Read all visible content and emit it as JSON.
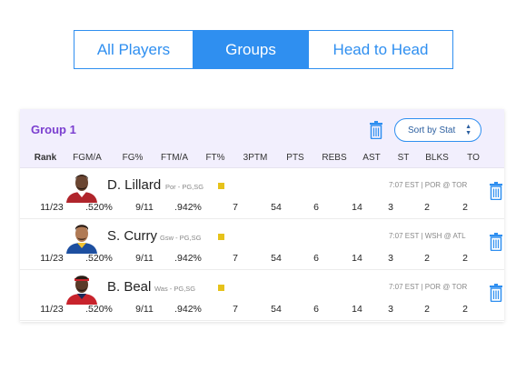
{
  "tabs": [
    {
      "label": "All Players",
      "active": false
    },
    {
      "label": "Groups",
      "active": true
    },
    {
      "label": "Head to Head",
      "active": false
    }
  ],
  "group": {
    "title": "Group 1",
    "sort_label": "Sort by Stat",
    "sort_icon": "up-down-arrows-icon",
    "delete_icon": "trash-icon"
  },
  "columns": [
    "Rank",
    "FGM/A",
    "FG%",
    "FTM/A",
    "FT%",
    "3PTM",
    "PTS",
    "REBS",
    "AST",
    "ST",
    "BLKS",
    "TO"
  ],
  "players": [
    {
      "name": "D. Lillard",
      "team_pos": "Por - PG,SG",
      "game": "7:07 EST | POR @ TOR",
      "stats": [
        "11/23",
        ".520%",
        "9/11",
        ".942%",
        "7",
        "54",
        "6",
        "14",
        "3",
        "2",
        "2"
      ]
    },
    {
      "name": "S. Curry",
      "team_pos": "Gsw - PG,SG",
      "game": "7:07 EST | WSH @ ATL",
      "stats": [
        "11/23",
        ".520%",
        "9/11",
        ".942%",
        "7",
        "54",
        "6",
        "14",
        "3",
        "2",
        "2"
      ]
    },
    {
      "name": "B. Beal",
      "team_pos": "Was - PG,SG",
      "game": "7:07 EST | POR @ TOR",
      "stats": [
        "11/23",
        ".520%",
        "9/11",
        ".942%",
        "7",
        "54",
        "6",
        "14",
        "3",
        "2",
        "2"
      ]
    }
  ],
  "colors": {
    "accent": "#2f8ff0",
    "group_title": "#7b3fd0",
    "header_bg": "#f2effd",
    "status": "#e6c21a"
  }
}
